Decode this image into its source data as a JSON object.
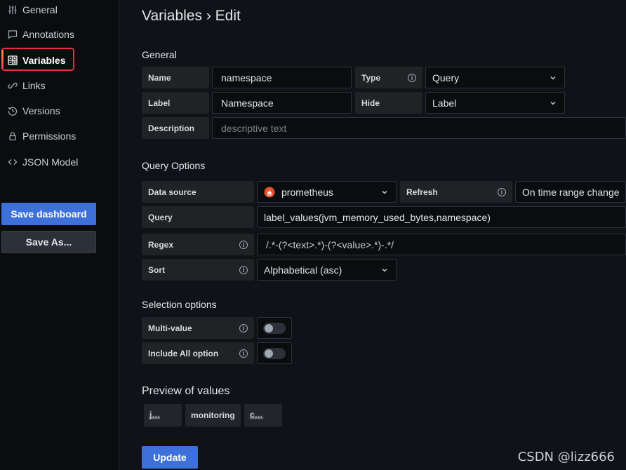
{
  "sidebar": {
    "items": [
      {
        "label": "General",
        "icon": "sliders-icon"
      },
      {
        "label": "Annotations",
        "icon": "comment-icon"
      },
      {
        "label": "Variables",
        "icon": "calculator-icon"
      },
      {
        "label": "Links",
        "icon": "link-icon"
      },
      {
        "label": "Versions",
        "icon": "history-icon"
      },
      {
        "label": "Permissions",
        "icon": "lock-icon"
      },
      {
        "label": "JSON Model",
        "icon": "code-icon"
      }
    ],
    "save_dashboard": "Save dashboard",
    "save_as": "Save As..."
  },
  "page": {
    "title": "Variables › Edit"
  },
  "general": {
    "section": "General",
    "name_label": "Name",
    "name_value": "namespace",
    "type_label": "Type",
    "type_value": "Query",
    "label_label": "Label",
    "label_value": "Namespace",
    "hide_label": "Hide",
    "hide_value": "Label",
    "description_label": "Description",
    "description_placeholder": "descriptive text"
  },
  "query_options": {
    "section": "Query Options",
    "datasource_label": "Data source",
    "datasource_value": "prometheus",
    "refresh_label": "Refresh",
    "refresh_value": "On time range change",
    "query_label": "Query",
    "query_value": "label_values(jvm_memory_used_bytes,namespace)",
    "regex_label": "Regex",
    "regex_value": "/.*-(?<text>.*)-(?<value>.*)-.*/",
    "sort_label": "Sort",
    "sort_value": "Alphabetical (asc)"
  },
  "selection_options": {
    "section": "Selection options",
    "multi_value_label": "Multi-value",
    "include_all_label": "Include All option"
  },
  "preview": {
    "section": "Preview of values",
    "values": [
      "j…",
      "monitoring",
      "c…"
    ]
  },
  "update_button": "Update",
  "watermark": "CSDN @lizz666",
  "colors": {
    "accent": "#3d71d9",
    "highlight": "#e02f44",
    "background": "#111217"
  }
}
